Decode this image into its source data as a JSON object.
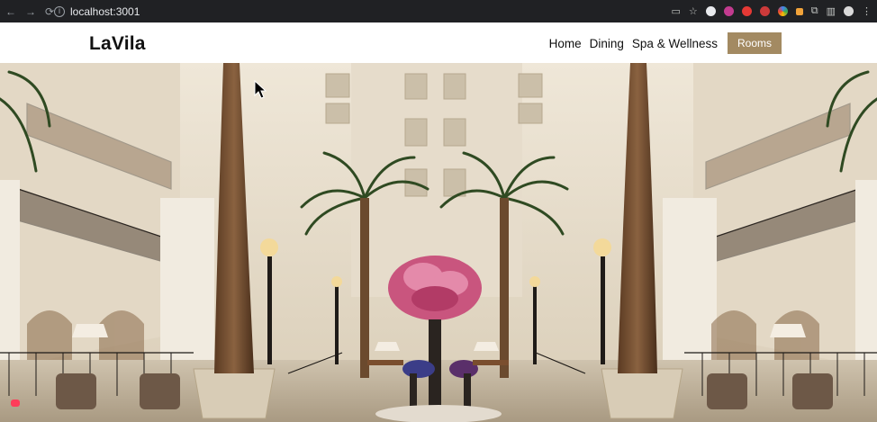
{
  "browser": {
    "url": "localhost:3001"
  },
  "site": {
    "logo": "LaVila",
    "nav": [
      {
        "label": "Home"
      },
      {
        "label": "Dining"
      },
      {
        "label": "Spa & Wellness"
      }
    ],
    "cta": "Rooms",
    "accent_color": "#a38a62"
  },
  "icons": {
    "back": "arrow-left-icon",
    "forward": "arrow-right-icon",
    "reload": "reload-icon",
    "site_info": "info-icon",
    "cast": "cast-icon",
    "bookmark": "star-icon",
    "extensions": "puzzle-icon",
    "sidebar": "sidebar-icon",
    "menu": "kebab-menu-icon"
  }
}
